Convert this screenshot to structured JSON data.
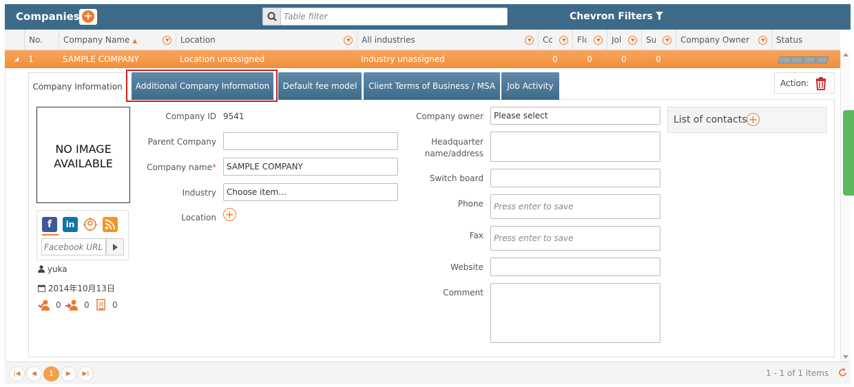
{
  "header": {
    "title": "Companies",
    "filter_placeholder": "Table filter",
    "chevron_filters": "Chevron Filters"
  },
  "columns": {
    "no": "No.",
    "company_name": "Company Name",
    "location": "Location",
    "industry": "All industries",
    "c1": "Cc",
    "c2": "Flc",
    "c3": "Jol",
    "c4": "Su",
    "owner": "Company Owner",
    "status": "Status"
  },
  "row": {
    "no": "1",
    "company_name": "SAMPLE COMPANY",
    "location": "Location unassigned",
    "industry": "Industry unassigned",
    "c1": "0",
    "c2": "0",
    "c3": "0",
    "c4": "0"
  },
  "tabs": [
    {
      "label": "Company Information"
    },
    {
      "label": "Additional Company Information"
    },
    {
      "label": "Default fee model"
    },
    {
      "label": "Client Terms of Business / MSA"
    },
    {
      "label": "Job Activity"
    }
  ],
  "action_label": "Action:",
  "no_image": {
    "line1": "NO IMAGE",
    "line2": "AVAILABLE"
  },
  "social": {
    "facebook_placeholder": "Facebook URL"
  },
  "meta": {
    "user": "yuka",
    "date": "2014年10月13日",
    "count1": "0",
    "count2": "0",
    "count3": "0"
  },
  "form_left": {
    "company_id_label": "Company ID",
    "company_id_value": "9541",
    "parent_company_label": "Parent Company",
    "parent_company_value": "",
    "company_name_label": "Company name",
    "company_name_value": "SAMPLE COMPANY",
    "required_mark": "*",
    "industry_label": "Industry",
    "industry_value": "Choose item...",
    "location_label": "Location"
  },
  "form_right": {
    "owner_label": "Company owner",
    "owner_value": "Please select",
    "hq_label_1": "Headquarter",
    "hq_label_2": "name/address",
    "switchboard_label": "Switch board",
    "phone_label": "Phone",
    "phone_placeholder": "Press enter to save",
    "fax_label": "Fax",
    "fax_placeholder": "Press enter to save",
    "website_label": "Website",
    "comment_label": "Comment"
  },
  "contacts": {
    "label": "List of contacts"
  },
  "pager": {
    "current_page": "1",
    "info": "1 - 1 of 1 items"
  },
  "colors": {
    "header_bg": "#3e6a8a",
    "accent": "#f07a2a",
    "selected_row": "#f49a4c",
    "highlight_border": "#cc1f1f"
  }
}
